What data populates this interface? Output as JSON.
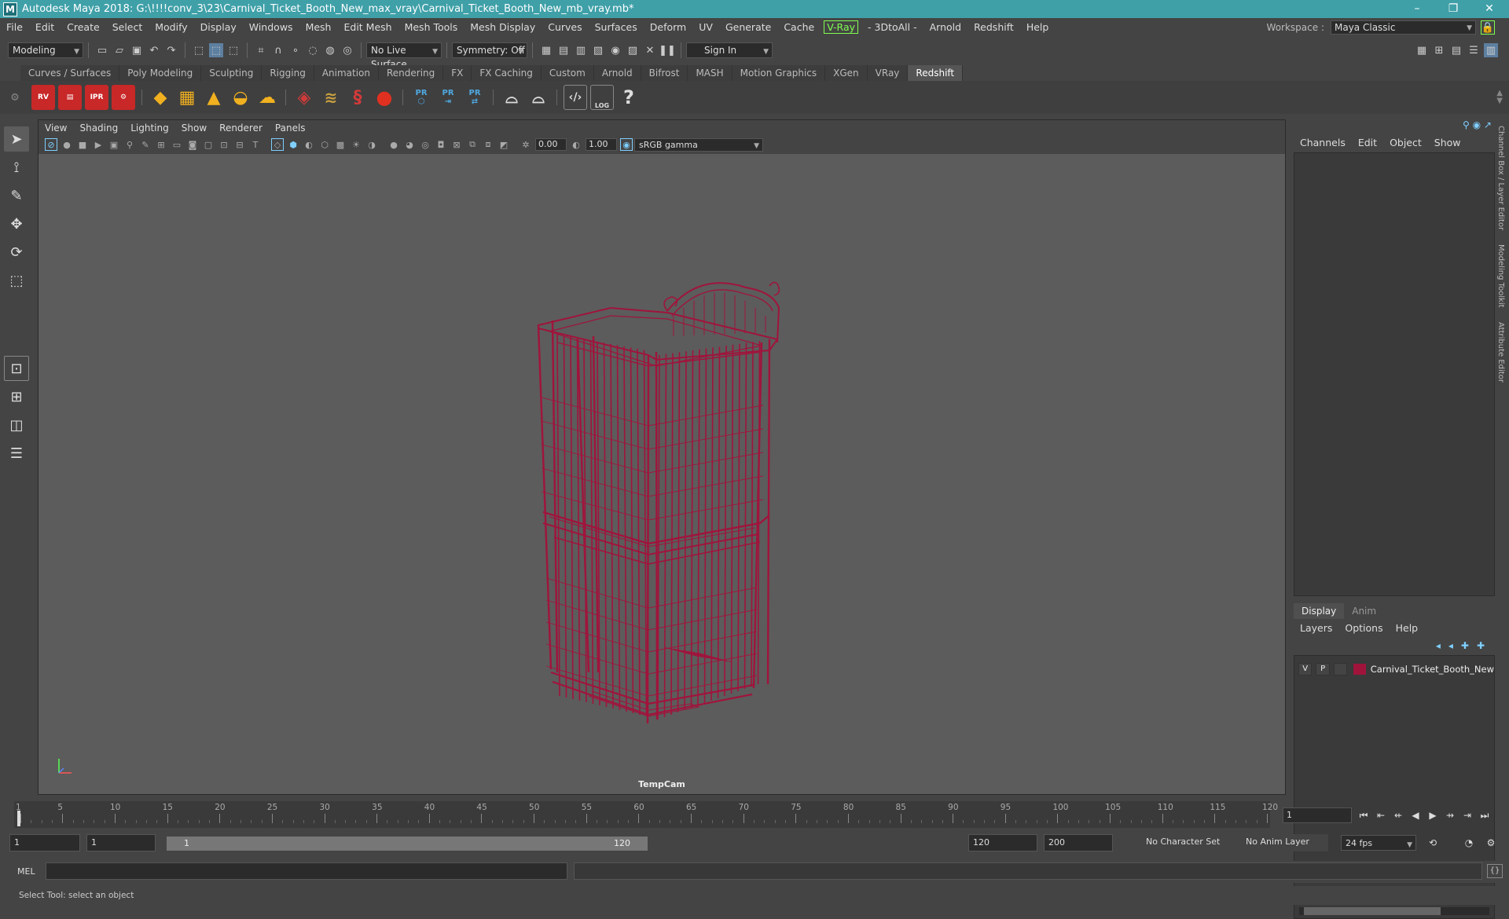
{
  "window": {
    "title": "Autodesk Maya 2018: G:\\!!!!conv_3\\23\\Carnival_Ticket_Booth_New_max_vray\\Carnival_Ticket_Booth_New_mb_vray.mb*",
    "logo": "M",
    "minimize": "–",
    "maximize": "❐",
    "close": "✕"
  },
  "menubar": {
    "items": [
      "File",
      "Edit",
      "Create",
      "Select",
      "Modify",
      "Display",
      "Windows",
      "Mesh",
      "Edit Mesh",
      "Mesh Tools",
      "Mesh Display",
      "Curves",
      "Surfaces",
      "Deform",
      "UV",
      "Generate",
      "Cache"
    ],
    "vray": "V-Ray",
    "items2": [
      "- 3DtoAll -",
      "Arnold",
      "Redshift",
      "Help"
    ],
    "workspace_label": "Workspace :",
    "workspace_value": "Maya Classic"
  },
  "statusline": {
    "mode": "Modeling",
    "live_surface": "No Live Surface",
    "symmetry": "Symmetry: Off",
    "sign_in": "Sign In"
  },
  "shelf": {
    "tabs": [
      "Curves / Surfaces",
      "Poly Modeling",
      "Sculpting",
      "Rigging",
      "Animation",
      "Rendering",
      "FX",
      "FX Caching",
      "Custom",
      "Arnold",
      "Bifrost",
      "MASH",
      "Motion Graphics",
      "XGen",
      "VRay",
      "Redshift"
    ],
    "active_tab": "Redshift",
    "icons": [
      "RV",
      "",
      "IPR",
      ""
    ],
    "pr_labels": [
      "PR",
      "PR",
      "PR"
    ],
    "log_label": "LOG"
  },
  "viewport": {
    "menu": [
      "View",
      "Shading",
      "Lighting",
      "Show",
      "Renderer",
      "Panels"
    ],
    "exposure": "0.00",
    "gamma": "1.00",
    "colorspace": "sRGB gamma",
    "camera": "TempCam",
    "wire_color": "#a0143c"
  },
  "channelbox": {
    "menu": [
      "Channels",
      "Edit",
      "Object",
      "Show"
    ],
    "side_tabs": [
      "Channel Box / Layer Editor",
      "Modeling Toolkit",
      "Attribute Editor"
    ]
  },
  "layer_editor": {
    "tabs": [
      "Display",
      "Anim"
    ],
    "menu": [
      "Layers",
      "Options",
      "Help"
    ],
    "layer": {
      "v": "V",
      "p": "P",
      "name": "Carnival_Ticket_Booth_New",
      "color": "#a0143c"
    }
  },
  "timeslider": {
    "ticks": [
      1,
      5,
      10,
      15,
      20,
      25,
      30,
      35,
      40,
      45,
      50,
      55,
      60,
      65,
      70,
      75,
      80,
      85,
      90,
      95,
      100,
      105,
      110,
      115,
      120
    ],
    "current_frame": "1"
  },
  "range": {
    "start": "1",
    "playback_start": "1",
    "slider_start": "1",
    "slider_end": "120",
    "playback_end": "120",
    "end": "200",
    "character_set": "No Character Set",
    "anim_layer": "No Anim Layer",
    "fps": "24 fps"
  },
  "cmdline": {
    "label": "MEL"
  },
  "helpline": {
    "text": "Select Tool: select an object"
  }
}
